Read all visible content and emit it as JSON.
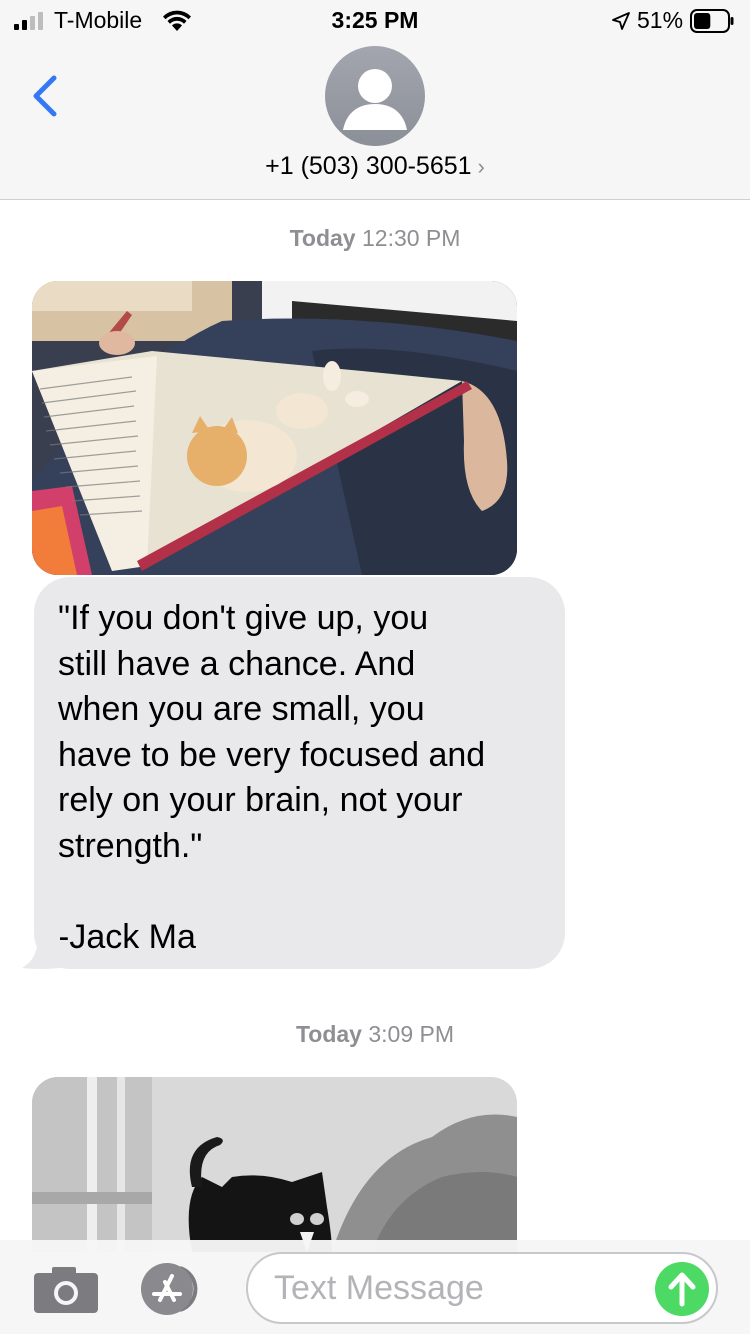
{
  "status_bar": {
    "carrier": "T-Mobile",
    "time": "3:25 PM",
    "battery_percent": "51%",
    "battery_level": 0.51
  },
  "header": {
    "contact": "+1 (503) 300-5651",
    "chevron": "›"
  },
  "thread": {
    "timestamps": [
      {
        "day": "Today",
        "time": "12:30 PM"
      },
      {
        "day": "Today",
        "time": "3:09 PM"
      }
    ],
    "messages": [
      {
        "type": "image",
        "description_icon": "photo-kitten-on-notebook"
      },
      {
        "type": "text",
        "lines": [
          "\"If you don't give up, you",
          "still have a chance. And",
          "when you are small, you",
          "have to be very focused and",
          "rely on your brain, not your",
          "strength.\"",
          "",
          "-Jack Ma"
        ]
      },
      {
        "type": "image",
        "description_icon": "photo-black-kitten"
      }
    ]
  },
  "composer": {
    "placeholder": "Text Message"
  },
  "icons": {
    "back": "chevron-left-icon",
    "avatar": "person-icon",
    "camera": "camera-icon",
    "apps": "app-store-icon",
    "send": "arrow-up-icon"
  },
  "colors": {
    "accent": "#3478f6",
    "bubble": "#e9e9eb",
    "send": "#4cd964",
    "timestamp": "#8e8e93"
  }
}
